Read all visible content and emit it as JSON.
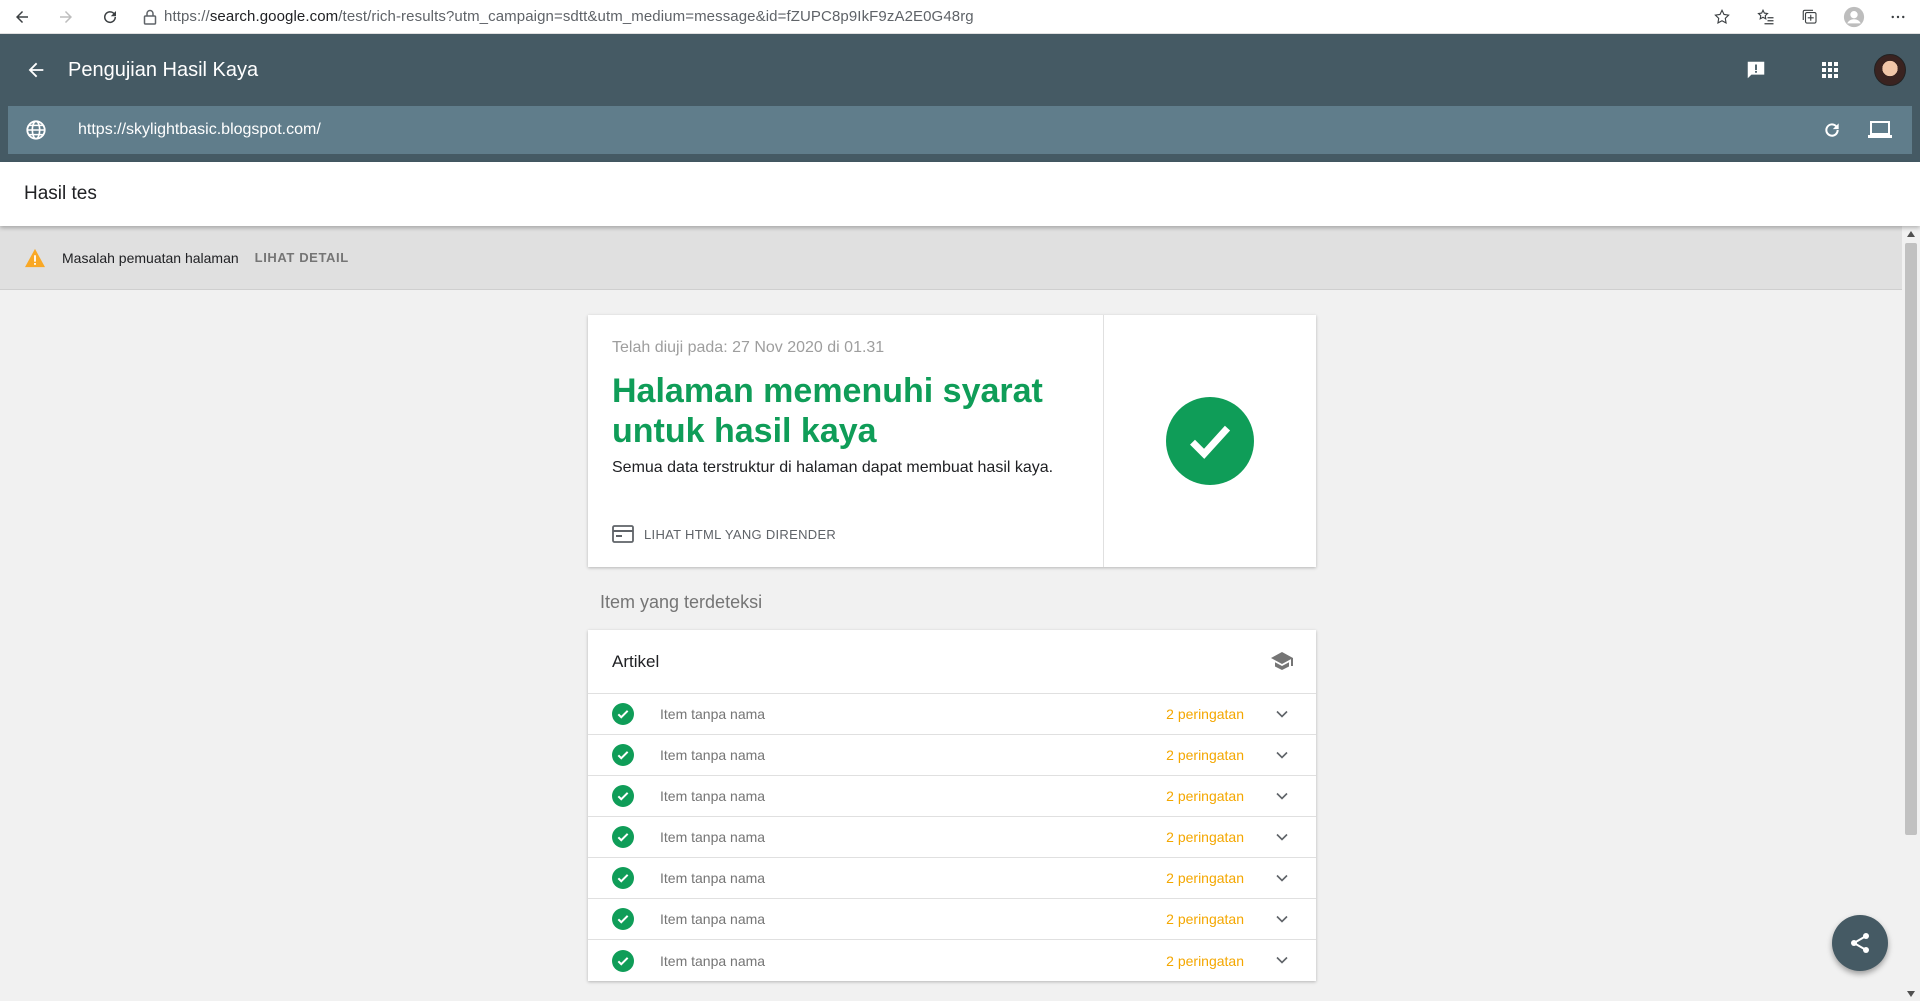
{
  "browser": {
    "url_prefix": "https://",
    "url_host": "search.google.com",
    "url_rest": "/test/rich-results?utm_campaign=sdtt&utm_medium=message&id=fZUPC8p9IkF9zA2E0G48rg"
  },
  "header": {
    "title": "Pengujian Hasil Kaya",
    "tested_url": "https://skylightbasic.blogspot.com/"
  },
  "section": {
    "title": "Hasil tes"
  },
  "warning": {
    "text": "Masalah pemuatan halaman",
    "link": "LIHAT DETAIL"
  },
  "result": {
    "tested_on": "Telah diuji pada: 27 Nov 2020 di 01.31",
    "headline": "Halaman memenuhi syarat untuk hasil kaya",
    "subtext": "Semua data terstruktur di halaman dapat membuat hasil kaya.",
    "rendered_link": "LIHAT HTML YANG DIRENDER"
  },
  "detected": {
    "label": "Item yang terdeteksi",
    "card_title": "Artikel",
    "items": [
      {
        "name": "Item tanpa nama",
        "warnings": "2 peringatan"
      },
      {
        "name": "Item tanpa nama",
        "warnings": "2 peringatan"
      },
      {
        "name": "Item tanpa nama",
        "warnings": "2 peringatan"
      },
      {
        "name": "Item tanpa nama",
        "warnings": "2 peringatan"
      },
      {
        "name": "Item tanpa nama",
        "warnings": "2 peringatan"
      },
      {
        "name": "Item tanpa nama",
        "warnings": "2 peringatan"
      },
      {
        "name": "Item tanpa nama",
        "warnings": "2 peringatan"
      }
    ]
  },
  "colors": {
    "header_bg": "#455a64",
    "url_bar_bg": "#607d8b",
    "success": "#0f9d58",
    "warning": "#f4a700"
  },
  "icons": {
    "browser": [
      "back-arrow-icon",
      "forward-arrow-icon",
      "refresh-icon",
      "lock-icon",
      "star-icon",
      "favorites-icon",
      "collections-icon",
      "profile-icon",
      "more-icon"
    ],
    "header": [
      "back-icon",
      "feedback-icon",
      "apps-grid-icon",
      "avatar"
    ],
    "url_bar": [
      "globe-icon",
      "retest-icon",
      "device-icon"
    ],
    "warning": "warning-triangle-icon",
    "result": [
      "rendered-html-icon",
      "check-circle-icon"
    ],
    "items": [
      "check-icon",
      "chevron-down-icon",
      "school-cap-icon"
    ],
    "fab": "share-icon"
  }
}
